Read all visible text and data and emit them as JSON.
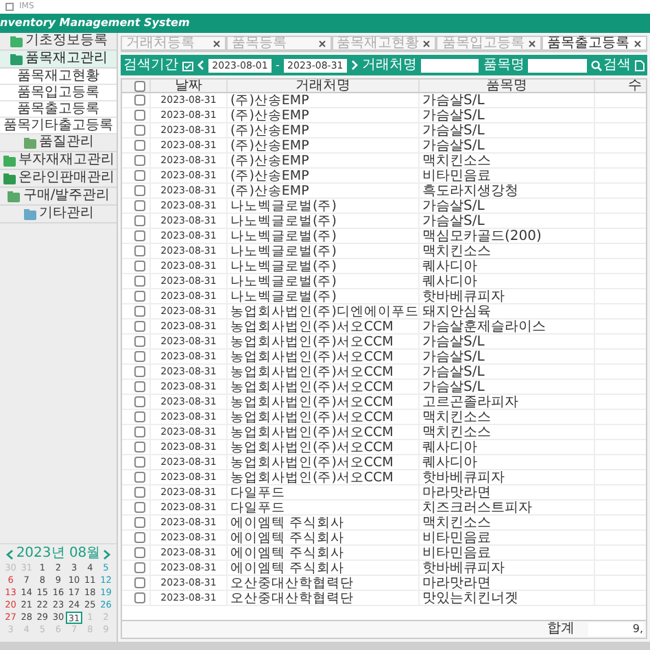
{
  "window": {
    "title": "IMS"
  },
  "header": {
    "title": "nventory Management System"
  },
  "sidebar": {
    "items": [
      {
        "label": "기초정보등록",
        "expanded": false
      },
      {
        "label": "품목재고관리",
        "expanded": true,
        "children": [
          {
            "label": "품목재고현황"
          },
          {
            "label": "품목입고등록"
          },
          {
            "label": "품목출고등록"
          },
          {
            "label": "품목기타출고등록"
          }
        ]
      },
      {
        "label": "품질관리",
        "expanded": false
      },
      {
        "label": "부자재재고관리",
        "expanded": false
      },
      {
        "label": "온라인판매관리",
        "expanded": false
      },
      {
        "label": "구매/발주관리",
        "expanded": false
      },
      {
        "label": "기타관리",
        "expanded": false
      }
    ]
  },
  "calendar": {
    "title": "2023년 08월",
    "days": [
      {
        "label": "30",
        "outside": true,
        "selected": false
      },
      {
        "label": "31",
        "outside": true,
        "selected": false
      },
      {
        "label": "1",
        "outside": false,
        "selected": false
      },
      {
        "label": "2",
        "outside": false,
        "selected": false
      },
      {
        "label": "3",
        "outside": false,
        "selected": false
      },
      {
        "label": "4",
        "outside": false,
        "selected": false
      },
      {
        "label": "5",
        "outside": false,
        "selected": false
      },
      {
        "label": "6",
        "outside": false,
        "selected": false
      },
      {
        "label": "7",
        "outside": false,
        "selected": false
      },
      {
        "label": "8",
        "outside": false,
        "selected": false
      },
      {
        "label": "9",
        "outside": false,
        "selected": false
      },
      {
        "label": "10",
        "outside": false,
        "selected": false
      },
      {
        "label": "11",
        "outside": false,
        "selected": false
      },
      {
        "label": "12",
        "outside": false,
        "selected": false
      },
      {
        "label": "13",
        "outside": false,
        "selected": false
      },
      {
        "label": "14",
        "outside": false,
        "selected": false
      },
      {
        "label": "15",
        "outside": false,
        "selected": false
      },
      {
        "label": "16",
        "outside": false,
        "selected": false
      },
      {
        "label": "17",
        "outside": false,
        "selected": false
      },
      {
        "label": "18",
        "outside": false,
        "selected": false
      },
      {
        "label": "19",
        "outside": false,
        "selected": false
      },
      {
        "label": "20",
        "outside": false,
        "selected": false
      },
      {
        "label": "21",
        "outside": false,
        "selected": false
      },
      {
        "label": "22",
        "outside": false,
        "selected": false
      },
      {
        "label": "23",
        "outside": false,
        "selected": false
      },
      {
        "label": "24",
        "outside": false,
        "selected": false
      },
      {
        "label": "25",
        "outside": false,
        "selected": false
      },
      {
        "label": "26",
        "outside": false,
        "selected": false
      },
      {
        "label": "27",
        "outside": false,
        "selected": false
      },
      {
        "label": "28",
        "outside": false,
        "selected": false
      },
      {
        "label": "29",
        "outside": false,
        "selected": false
      },
      {
        "label": "30",
        "outside": false,
        "selected": false
      },
      {
        "label": "31",
        "outside": false,
        "selected": true
      },
      {
        "label": "1",
        "outside": true,
        "selected": false
      },
      {
        "label": "2",
        "outside": true,
        "selected": false
      },
      {
        "label": "3",
        "outside": true,
        "selected": false
      },
      {
        "label": "4",
        "outside": true,
        "selected": false
      },
      {
        "label": "5",
        "outside": true,
        "selected": false
      },
      {
        "label": "6",
        "outside": true,
        "selected": false
      },
      {
        "label": "7",
        "outside": true,
        "selected": false
      },
      {
        "label": "8",
        "outside": true,
        "selected": false
      },
      {
        "label": "9",
        "outside": true,
        "selected": false
      }
    ]
  },
  "tabs": [
    {
      "label": "거래처등록",
      "selected": false
    },
    {
      "label": "품목등록",
      "selected": false
    },
    {
      "label": "품목재고현황",
      "selected": false
    },
    {
      "label": "품목입고등록",
      "selected": false
    },
    {
      "label": "품목출고등록",
      "selected": true
    }
  ],
  "search": {
    "period_label": "검색기간",
    "date_from": "2023-08-01",
    "separator": "-",
    "date_to": "2023-08-31",
    "client_label": "거래처명",
    "item_label": "품목명",
    "search_button": "검색"
  },
  "table": {
    "header_checked": false,
    "columns": [
      "날짜",
      "거래처명",
      "품목명",
      "수"
    ],
    "rows": [
      {
        "checked": false,
        "date": "2023-08-31",
        "client": "(주)산송EMP",
        "item": "가슴살S/L"
      },
      {
        "checked": false,
        "date": "2023-08-31",
        "client": "(주)산송EMP",
        "item": "가슴살S/L"
      },
      {
        "checked": false,
        "date": "2023-08-31",
        "client": "(주)산송EMP",
        "item": "가슴살S/L"
      },
      {
        "checked": false,
        "date": "2023-08-31",
        "client": "(주)산송EMP",
        "item": "가슴살S/L"
      },
      {
        "checked": false,
        "date": "2023-08-31",
        "client": "(주)산송EMP",
        "item": "맥치킨소스"
      },
      {
        "checked": false,
        "date": "2023-08-31",
        "client": "(주)산송EMP",
        "item": "비타민음료"
      },
      {
        "checked": false,
        "date": "2023-08-31",
        "client": "(주)산송EMP",
        "item": "흑도라지생강청"
      },
      {
        "checked": false,
        "date": "2023-08-31",
        "client": "나노벡글로벌(주)",
        "item": "가슴살S/L"
      },
      {
        "checked": false,
        "date": "2023-08-31",
        "client": "나노벡글로벌(주)",
        "item": "가슴살S/L"
      },
      {
        "checked": false,
        "date": "2023-08-31",
        "client": "나노벡글로벌(주)",
        "item": "맥심모카골드(200)"
      },
      {
        "checked": false,
        "date": "2023-08-31",
        "client": "나노벡글로벌(주)",
        "item": "맥치킨소스"
      },
      {
        "checked": false,
        "date": "2023-08-31",
        "client": "나노벡글로벌(주)",
        "item": "퀘사디아"
      },
      {
        "checked": false,
        "date": "2023-08-31",
        "client": "나노벡글로벌(주)",
        "item": "퀘사디아"
      },
      {
        "checked": false,
        "date": "2023-08-31",
        "client": "나노벡글로벌(주)",
        "item": "핫바베큐피자"
      },
      {
        "checked": false,
        "date": "2023-08-31",
        "client": "농업회사법인(주)디엔에이푸드",
        "item": "돼지안심육"
      },
      {
        "checked": false,
        "date": "2023-08-31",
        "client": "농업회사법인(주)서오CCM",
        "item": "가슴살훈제슬라이스"
      },
      {
        "checked": false,
        "date": "2023-08-31",
        "client": "농업회사법인(주)서오CCM",
        "item": "가슴살S/L"
      },
      {
        "checked": false,
        "date": "2023-08-31",
        "client": "농업회사법인(주)서오CCM",
        "item": "가슴살S/L"
      },
      {
        "checked": false,
        "date": "2023-08-31",
        "client": "농업회사법인(주)서오CCM",
        "item": "가슴살S/L"
      },
      {
        "checked": false,
        "date": "2023-08-31",
        "client": "농업회사법인(주)서오CCM",
        "item": "가슴살S/L"
      },
      {
        "checked": false,
        "date": "2023-08-31",
        "client": "농업회사법인(주)서오CCM",
        "item": "고르곤졸라피자"
      },
      {
        "checked": false,
        "date": "2023-08-31",
        "client": "농업회사법인(주)서오CCM",
        "item": "맥치킨소스"
      },
      {
        "checked": false,
        "date": "2023-08-31",
        "client": "농업회사법인(주)서오CCM",
        "item": "맥치킨소스"
      },
      {
        "checked": false,
        "date": "2023-08-31",
        "client": "농업회사법인(주)서오CCM",
        "item": "퀘사디아"
      },
      {
        "checked": false,
        "date": "2023-08-31",
        "client": "농업회사법인(주)서오CCM",
        "item": "퀘사디아"
      },
      {
        "checked": false,
        "date": "2023-08-31",
        "client": "농업회사법인(주)서오CCM",
        "item": "핫바베큐피자"
      },
      {
        "checked": false,
        "date": "2023-08-31",
        "client": "다일푸드",
        "item": "마라맛라면"
      },
      {
        "checked": false,
        "date": "2023-08-31",
        "client": "다일푸드",
        "item": "치즈크러스트피자"
      },
      {
        "checked": false,
        "date": "2023-08-31",
        "client": "에이엠텍 주식회사",
        "item": "맥치킨소스"
      },
      {
        "checked": false,
        "date": "2023-08-31",
        "client": "에이엠텍 주식회사",
        "item": "비타민음료"
      },
      {
        "checked": false,
        "date": "2023-08-31",
        "client": "에이엠텍 주식회사",
        "item": "비타민음료"
      },
      {
        "checked": false,
        "date": "2023-08-31",
        "client": "에이엠텍 주식회사",
        "item": "핫바베큐피자"
      },
      {
        "checked": false,
        "date": "2023-08-31",
        "client": "오산중대산학협력단",
        "item": "마라맛라면"
      },
      {
        "checked": false,
        "date": "2023-08-31",
        "client": "오산중대산학협력단",
        "item": "맛있는치킨너겟"
      }
    ],
    "total_label": "합계",
    "total_value": "9,"
  }
}
